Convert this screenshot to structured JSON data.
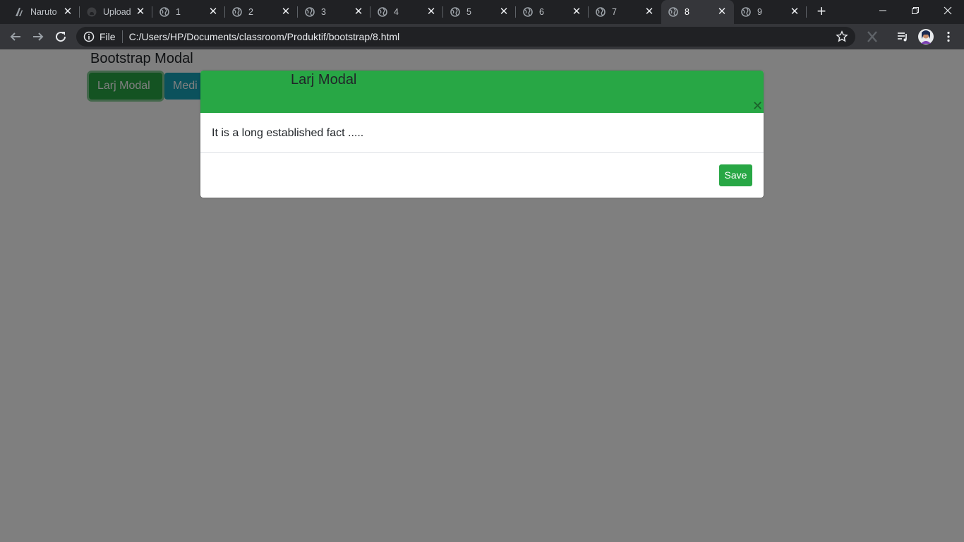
{
  "browser": {
    "tabs": [
      {
        "title": "Naruto",
        "icon": "naruto-favicon-icon",
        "active": false
      },
      {
        "title": "Upload",
        "icon": "github-icon",
        "active": false
      },
      {
        "title": "1",
        "icon": "globe-icon",
        "active": false
      },
      {
        "title": "2",
        "icon": "globe-icon",
        "active": false
      },
      {
        "title": "3",
        "icon": "globe-icon",
        "active": false
      },
      {
        "title": "4",
        "icon": "globe-icon",
        "active": false
      },
      {
        "title": "5",
        "icon": "globe-icon",
        "active": false
      },
      {
        "title": "6",
        "icon": "globe-icon",
        "active": false
      },
      {
        "title": "7",
        "icon": "globe-icon",
        "active": false
      },
      {
        "title": "8",
        "icon": "globe-icon",
        "active": true
      },
      {
        "title": "9",
        "icon": "globe-icon",
        "active": false
      }
    ],
    "omnibox": {
      "scheme": "File",
      "url": "C:/Users/HP/Documents/classroom/Produktif/bootstrap/8.html"
    }
  },
  "page": {
    "heading": "Bootstrap Modal",
    "buttons": {
      "large": "Larj Modal",
      "medium": "Medi"
    }
  },
  "modal": {
    "title": "Larj Modal",
    "body": "It is a long established fact .....",
    "save_label": "Save"
  },
  "colors": {
    "success": "#28a745",
    "info": "#17a2b8",
    "chrome_dark": "#202124",
    "chrome_toolbar": "#35363a"
  }
}
